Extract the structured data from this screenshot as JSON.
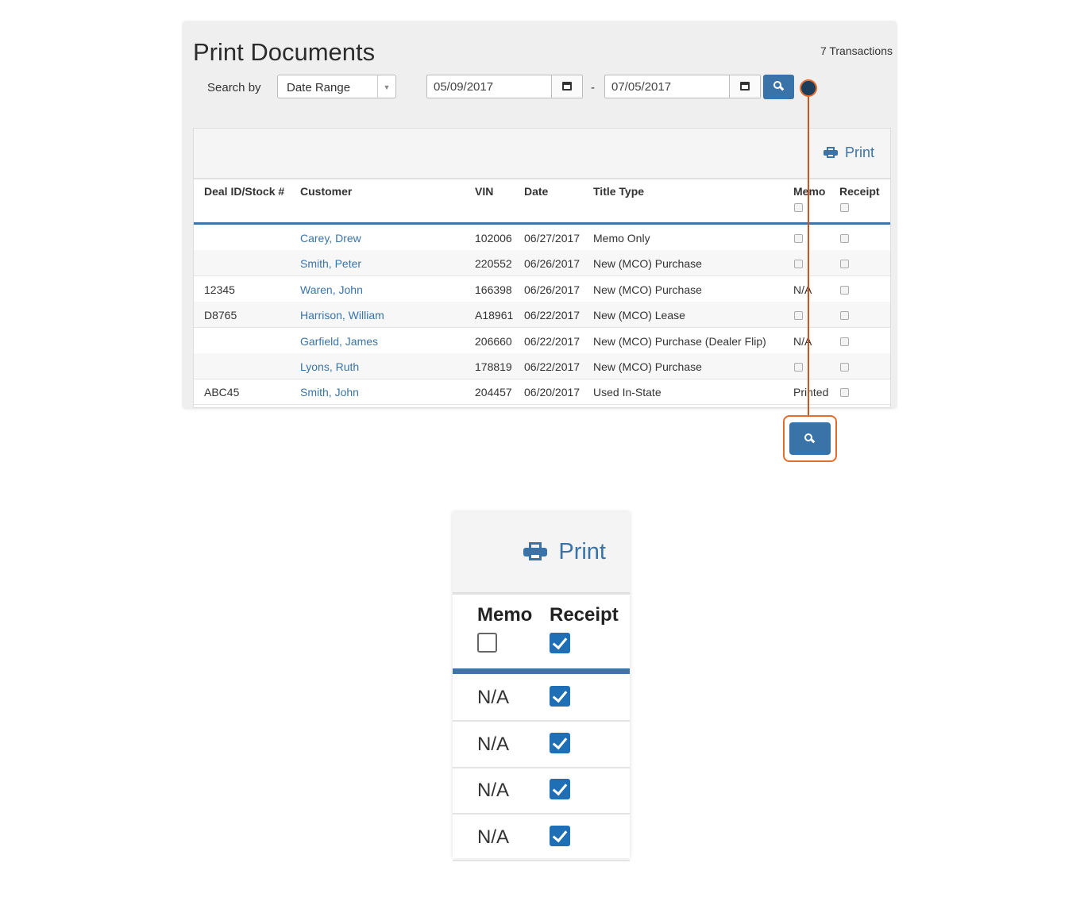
{
  "page": {
    "title": "Print Documents",
    "transaction_count": "7 Transactions",
    "search_by_label": "Search by",
    "search_by_value": "Date Range",
    "date_from": "05/09/2017",
    "date_separator": "-",
    "date_to": "07/05/2017"
  },
  "table": {
    "print_label": "Print",
    "headers": [
      "Deal ID/Stock #",
      "Customer",
      "VIN",
      "Date",
      "Title Type",
      "Memo",
      "Receipt"
    ],
    "rows": [
      {
        "deal": "",
        "customer": "Carey, Drew",
        "vin": "102006",
        "date": "06/27/2017",
        "title_type": "Memo Only",
        "memo": "",
        "receipt": ""
      },
      {
        "deal": "",
        "customer": "Smith, Peter",
        "vin": "220552",
        "date": "06/26/2017",
        "title_type": "New (MCO) Purchase",
        "memo": "",
        "receipt": ""
      },
      {
        "deal": "12345",
        "customer": "Waren, John",
        "vin": "166398",
        "date": "06/26/2017",
        "title_type": "New (MCO) Purchase",
        "memo": "N/A",
        "receipt": ""
      },
      {
        "deal": "D8765",
        "customer": "Harrison, William",
        "vin": "A18961",
        "date": "06/22/2017",
        "title_type": "New (MCO) Lease",
        "memo": "",
        "receipt": ""
      },
      {
        "deal": "",
        "customer": "Garfield, James",
        "vin": "206660",
        "date": "06/22/2017",
        "title_type": "New (MCO) Purchase (Dealer Flip)",
        "memo": "N/A",
        "receipt": ""
      },
      {
        "deal": "",
        "customer": "Lyons, Ruth",
        "vin": "178819",
        "date": "06/22/2017",
        "title_type": "New (MCO) Purchase",
        "memo": "",
        "receipt": ""
      },
      {
        "deal": "ABC45",
        "customer": "Smith, John",
        "vin": "204457",
        "date": "06/20/2017",
        "title_type": "Used In-State",
        "memo": "Printed",
        "receipt": ""
      }
    ]
  },
  "zoom": {
    "print_label": "Print",
    "memo_header": "Memo",
    "receipt_header": "Receipt",
    "rows": [
      "N/A",
      "N/A",
      "N/A",
      "N/A"
    ]
  },
  "colors": {
    "accent": "#3a73a8",
    "callout": "#e46c2c",
    "checkbox_checked": "#1f6fb6"
  }
}
